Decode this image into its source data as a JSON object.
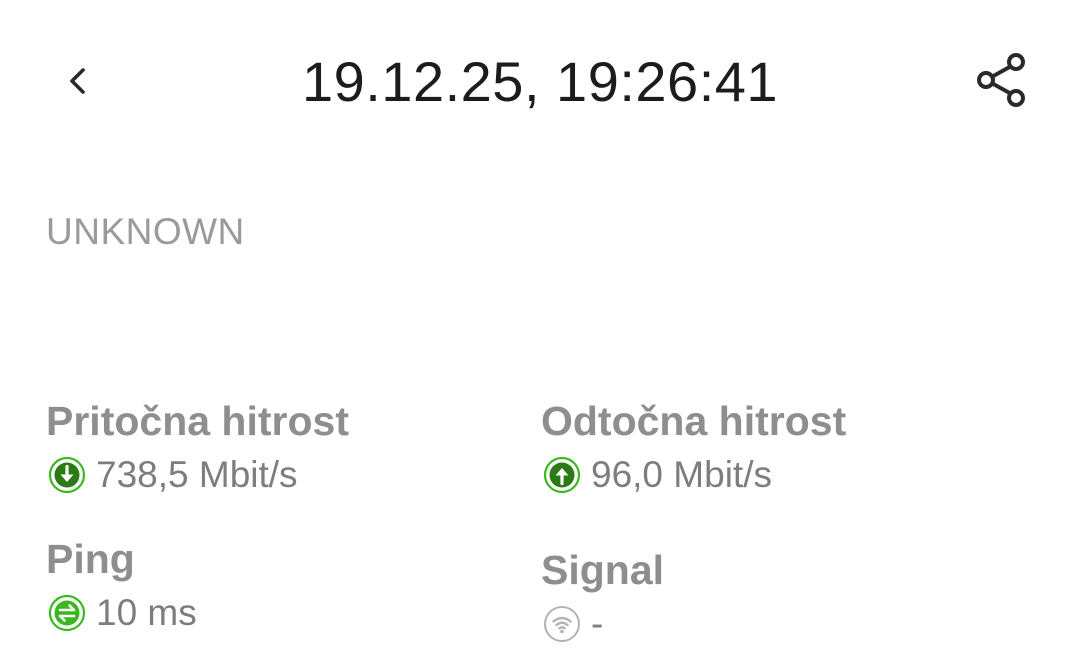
{
  "header": {
    "title": "19.12.25, 19:26:41",
    "back_icon": "chevron-left-icon",
    "share_icon": "share-icon"
  },
  "network_type": "UNKNOWN",
  "metrics": {
    "download": {
      "label": "Pritočna hitrost",
      "value": "738,5 Mbit/s",
      "icon": "download-arrow-icon"
    },
    "upload": {
      "label": "Odtočna hitrost",
      "value": "96,0 Mbit/s",
      "icon": "upload-arrow-icon"
    },
    "ping": {
      "label": "Ping",
      "value": "10 ms",
      "icon": "ping-arrows-icon"
    },
    "signal": {
      "label": "Signal",
      "value": "-",
      "icon": "wifi-icon"
    }
  },
  "colors": {
    "title": "#1c1c1c",
    "label": "#8e8e8e",
    "value": "#7d7d7d",
    "muted": "#9a9a9a",
    "good_dark": "#2b7a14",
    "good_light": "#3cb81e",
    "neutral_icon": "#b3b3b3"
  }
}
